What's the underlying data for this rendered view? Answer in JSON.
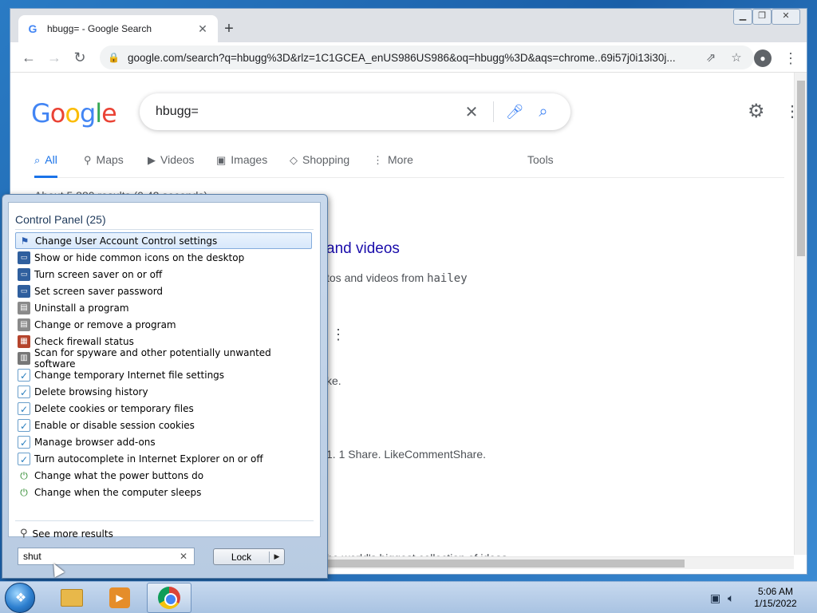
{
  "browser": {
    "tab_title": "hbugg= - Google Search",
    "tab_close": "✕",
    "new_tab": "+",
    "url": "google.com/search?q=hbugg%3D&rlz=1C1GCEA_enUS986US986&oq=hbugg%3D&aqs=chrome..69i57j0i13i30j..."
  },
  "google": {
    "logo_letters": [
      "G",
      "o",
      "o",
      "g",
      "l",
      "e"
    ],
    "query": "hbugg=",
    "tabs": [
      {
        "icon": "search-icon",
        "label": "All",
        "active": true
      },
      {
        "icon": "map-pin-icon",
        "label": "Maps"
      },
      {
        "icon": "video-icon",
        "label": "Videos"
      },
      {
        "icon": "image-icon",
        "label": "Images"
      },
      {
        "icon": "tag-icon",
        "label": "Shopping"
      },
      {
        "icon": "more-icon",
        "label": "More"
      }
    ],
    "tools_label": "Tools",
    "result_stats": "About 5,880 results (0.42 seconds)",
    "partial_result_title": "and videos",
    "partial_snippet_1a": "tos and videos from ",
    "partial_snippet_1b": "hailey",
    "partial_snippet_2": "ke.",
    "partial_snippet_3": "1. 1 Share. LikeCommentShare.",
    "partial_snippet_4": "he world's biggest collection of ideas."
  },
  "start_menu": {
    "header": "Control Panel (25)",
    "items": [
      {
        "label": "Change User Account Control settings",
        "icon": "uac-flag-icon",
        "selected": true
      },
      {
        "label": "Show or hide common icons on the desktop",
        "icon": "monitor-icon"
      },
      {
        "label": "Turn screen saver on or off",
        "icon": "monitor-icon"
      },
      {
        "label": "Set screen saver password",
        "icon": "monitor-icon"
      },
      {
        "label": "Uninstall a program",
        "icon": "programs-icon"
      },
      {
        "label": "Change or remove a program",
        "icon": "programs-icon"
      },
      {
        "label": "Check firewall status",
        "icon": "firewall-icon"
      },
      {
        "label": "Scan for spyware and other potentially unwanted software",
        "icon": "defender-icon"
      },
      {
        "label": "Change temporary Internet file settings",
        "icon": "internet-options-icon"
      },
      {
        "label": "Delete browsing history",
        "icon": "internet-options-icon"
      },
      {
        "label": "Delete cookies or temporary files",
        "icon": "internet-options-icon"
      },
      {
        "label": "Enable or disable session cookies",
        "icon": "internet-options-icon"
      },
      {
        "label": "Manage browser add-ons",
        "icon": "internet-options-icon"
      },
      {
        "label": "Turn autocomplete in Internet Explorer on or off",
        "icon": "internet-options-icon"
      },
      {
        "label": "Change what the power buttons do",
        "icon": "power-options-icon"
      },
      {
        "label": "Change when the computer sleeps",
        "icon": "power-options-icon"
      }
    ],
    "see_more": "See more results",
    "search_value": "shut",
    "lock_label": "Lock"
  },
  "taskbar": {
    "time": "5:06 AM",
    "date": "1/15/2022"
  }
}
